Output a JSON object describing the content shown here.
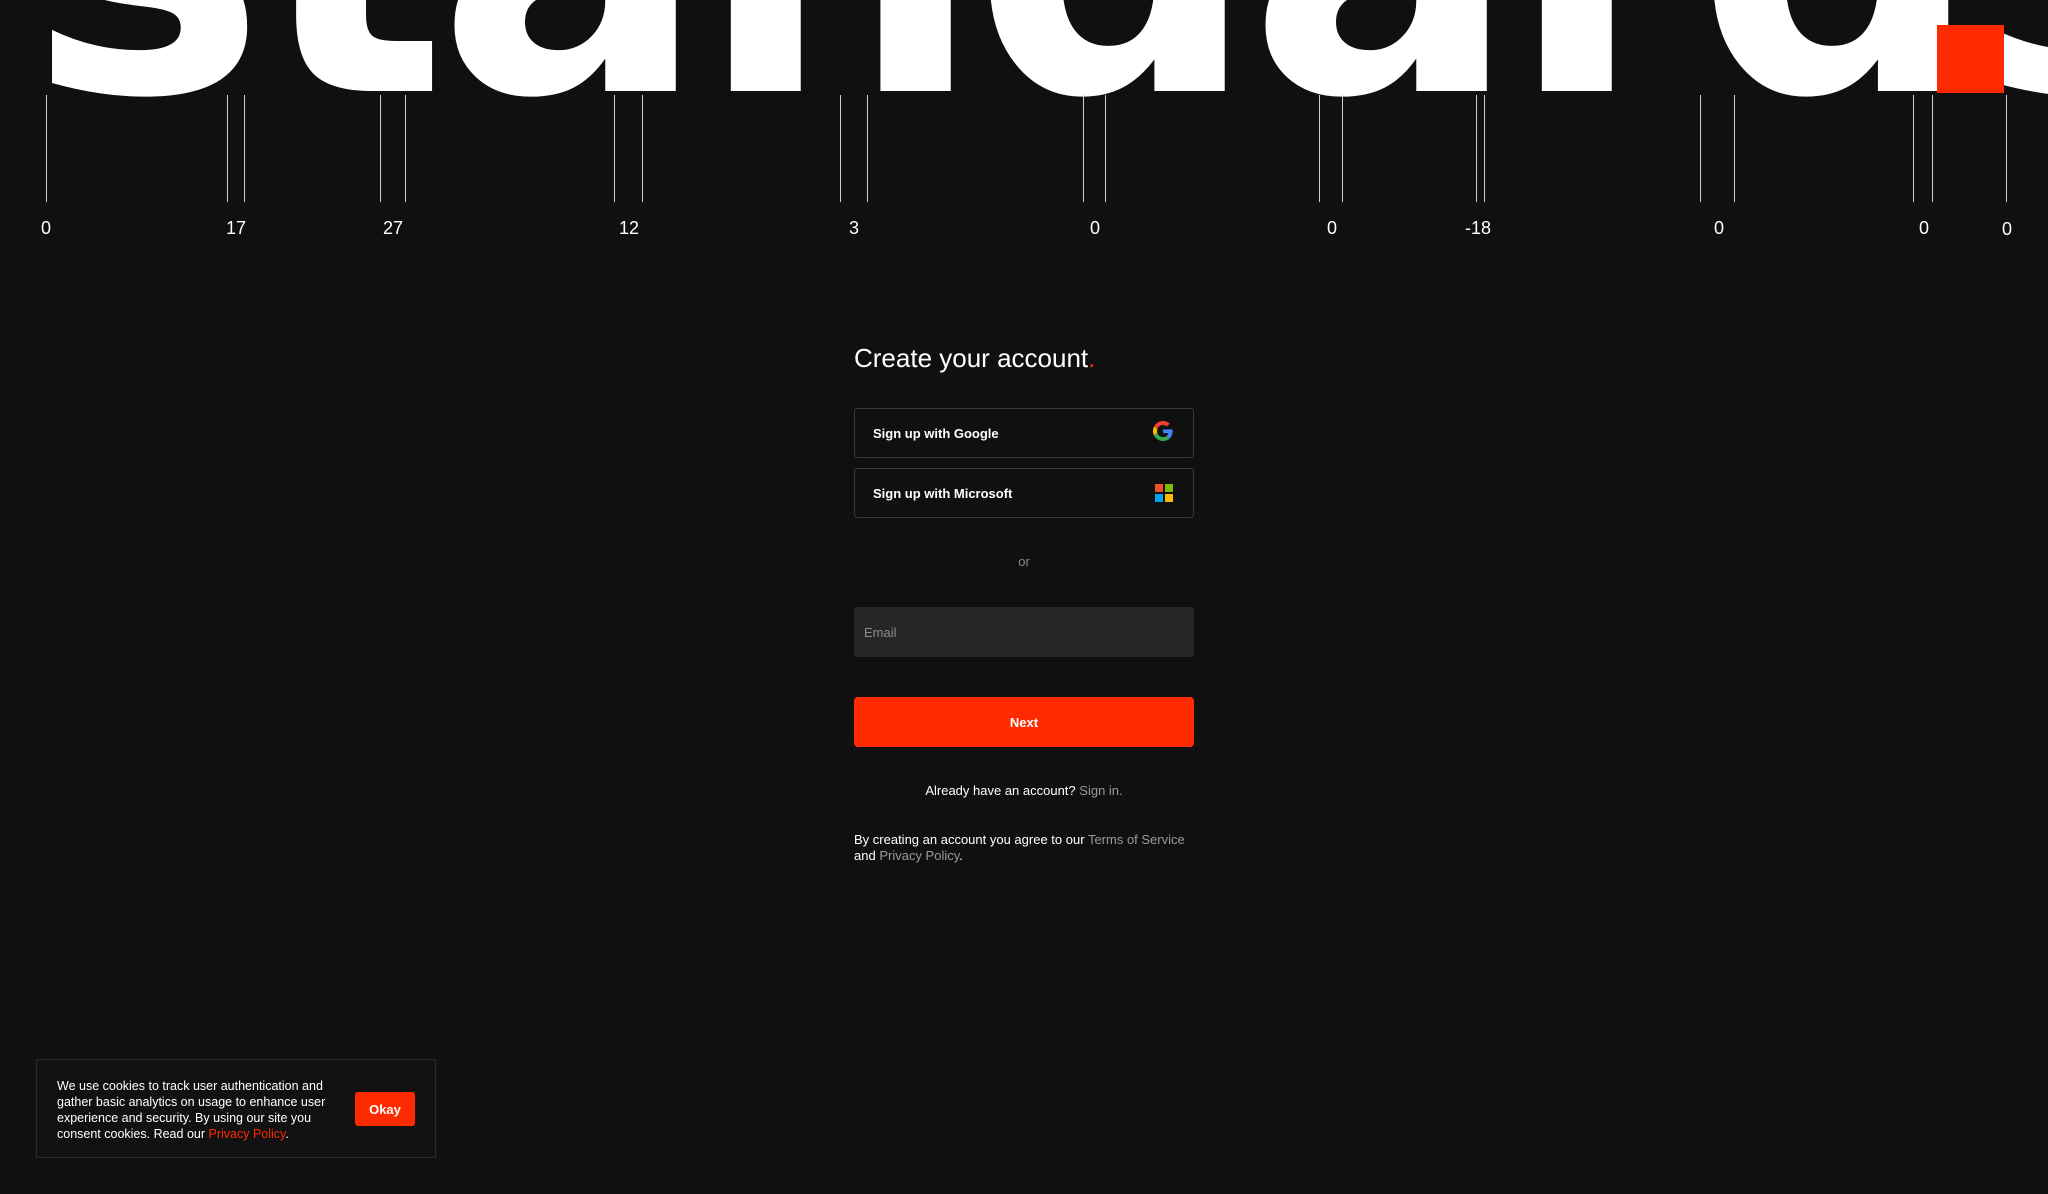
{
  "hero": {
    "wordmark": "standards",
    "ruler_labels": [
      "0",
      "17",
      "27",
      "12",
      "3",
      "0",
      "0",
      "-18",
      "0",
      "0",
      "0"
    ]
  },
  "signup": {
    "title": "Create your account",
    "title_dot": ".",
    "google_label": "Sign up with Google",
    "microsoft_label": "Sign up with Microsoft",
    "or_label": "or",
    "email_placeholder": "Email",
    "email_value": "",
    "next_label": "Next",
    "have_account_text": "Already have an account?",
    "sign_in_link": "Sign in.",
    "terms_prefix": "By creating an account you agree to our",
    "terms_link": "Terms of Service",
    "terms_and": "and",
    "privacy_link": "Privacy Policy",
    "terms_end": "."
  },
  "cookie": {
    "text": "We use cookies to track user authentication and gather basic analytics on usage to enhance user experience and security. By using our site you consent cookies. Read our",
    "privacy_link": "Privacy Policy",
    "end": ".",
    "okay_label": "Okay"
  },
  "icons": {
    "google": "google-icon",
    "microsoft": "microsoft-icon"
  },
  "colors": {
    "background": "#101010",
    "accent": "#ff2a00",
    "text": "#ffffff",
    "muted": "#9a9a9a",
    "input_bg": "#262626",
    "ms_red": "#f25022",
    "ms_green": "#7fba00",
    "ms_blue": "#00a4ef",
    "ms_yellow": "#ffb900"
  }
}
